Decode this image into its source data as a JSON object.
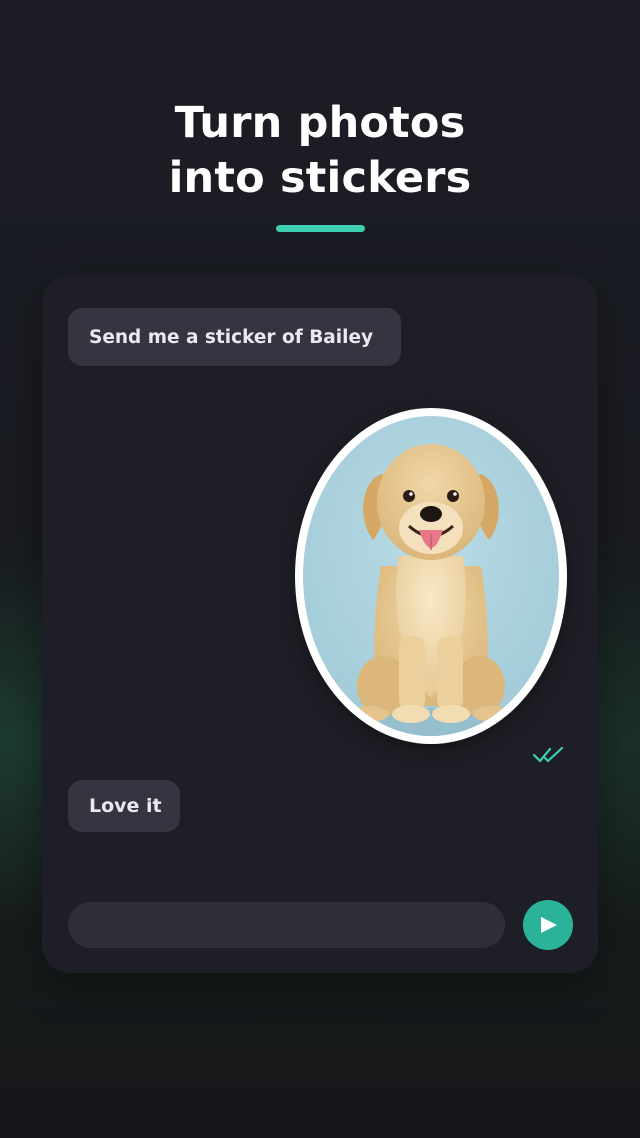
{
  "headline": {
    "line1": "Turn photos",
    "line2": "into stickers"
  },
  "chat": {
    "messages": [
      {
        "from": "user",
        "text": "Send me a sticker of Bailey"
      },
      {
        "from": "bot",
        "type": "sticker",
        "subject": "golden retriever puppy",
        "icon": "sticker-image"
      },
      {
        "from": "user",
        "text": "Love it"
      }
    ],
    "read_receipt_icon": "double-check-icon",
    "input": {
      "value": "",
      "placeholder": ""
    },
    "send_icon": "play-triangle-icon"
  },
  "colors": {
    "accent": "#3ecfb2",
    "send_button": "#2bb39a",
    "sticker_background": "#aed3df",
    "bubble": "#343540",
    "card": "#1e1f26"
  }
}
